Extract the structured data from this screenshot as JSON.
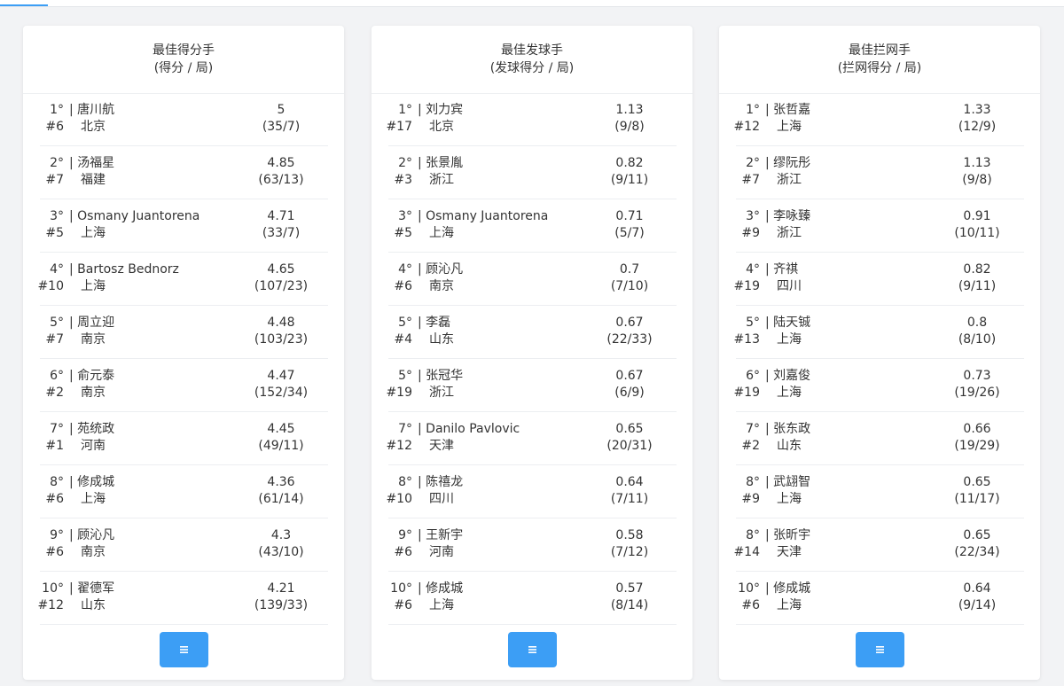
{
  "cards": [
    {
      "title": "最佳得分手",
      "subtitle": "(得分 / 局)",
      "rows": [
        {
          "rank": "1°",
          "number": "#6",
          "name": "| 唐川航",
          "team": "北京",
          "value": "5",
          "ratio": "(35/7)"
        },
        {
          "rank": "2°",
          "number": "#7",
          "name": "| 汤福星",
          "team": "福建",
          "value": "4.85",
          "ratio": "(63/13)"
        },
        {
          "rank": "3°",
          "number": "#5",
          "name": "| Osmany Juantorena",
          "team": "上海",
          "value": "4.71",
          "ratio": "(33/7)"
        },
        {
          "rank": "4°",
          "number": "#10",
          "name": "| Bartosz Bednorz",
          "team": "上海",
          "value": "4.65",
          "ratio": "(107/23)"
        },
        {
          "rank": "5°",
          "number": "#7",
          "name": "| 周立迎",
          "team": "南京",
          "value": "4.48",
          "ratio": "(103/23)"
        },
        {
          "rank": "6°",
          "number": "#2",
          "name": "| 俞元泰",
          "team": "南京",
          "value": "4.47",
          "ratio": "(152/34)"
        },
        {
          "rank": "7°",
          "number": "#1",
          "name": "| 苑统政",
          "team": "河南",
          "value": "4.45",
          "ratio": "(49/11)"
        },
        {
          "rank": "8°",
          "number": "#6",
          "name": "| 修成城",
          "team": "上海",
          "value": "4.36",
          "ratio": "(61/14)"
        },
        {
          "rank": "9°",
          "number": "#6",
          "name": "| 顾沁凡",
          "team": "南京",
          "value": "4.3",
          "ratio": "(43/10)"
        },
        {
          "rank": "10°",
          "number": "#12",
          "name": "| 翟德军",
          "team": "山东",
          "value": "4.21",
          "ratio": "(139/33)"
        }
      ],
      "button_icon": "list-icon"
    },
    {
      "title": "最佳发球手",
      "subtitle": "(发球得分 / 局)",
      "rows": [
        {
          "rank": "1°",
          "number": "#17",
          "name": "| 刘力宾",
          "team": "北京",
          "value": "1.13",
          "ratio": "(9/8)"
        },
        {
          "rank": "2°",
          "number": "#3",
          "name": "| 张景胤",
          "team": "浙江",
          "value": "0.82",
          "ratio": "(9/11)"
        },
        {
          "rank": "3°",
          "number": "#5",
          "name": "| Osmany Juantorena",
          "team": "上海",
          "value": "0.71",
          "ratio": "(5/7)"
        },
        {
          "rank": "4°",
          "number": "#6",
          "name": "| 顾沁凡",
          "team": "南京",
          "value": "0.7",
          "ratio": "(7/10)"
        },
        {
          "rank": "5°",
          "number": "#4",
          "name": "| 李磊",
          "team": "山东",
          "value": "0.67",
          "ratio": "(22/33)"
        },
        {
          "rank": "5°",
          "number": "#19",
          "name": "| 张冠华",
          "team": "浙江",
          "value": "0.67",
          "ratio": "(6/9)"
        },
        {
          "rank": "7°",
          "number": "#12",
          "name": "| Danilo Pavlovic",
          "team": "天津",
          "value": "0.65",
          "ratio": "(20/31)"
        },
        {
          "rank": "8°",
          "number": "#10",
          "name": "| 陈禧龙",
          "team": "四川",
          "value": "0.64",
          "ratio": "(7/11)"
        },
        {
          "rank": "9°",
          "number": "#6",
          "name": "| 王新宇",
          "team": "河南",
          "value": "0.58",
          "ratio": "(7/12)"
        },
        {
          "rank": "10°",
          "number": "#6",
          "name": "| 修成城",
          "team": "上海",
          "value": "0.57",
          "ratio": "(8/14)"
        }
      ],
      "button_icon": "list-icon"
    },
    {
      "title": "最佳拦网手",
      "subtitle": "(拦网得分 / 局)",
      "rows": [
        {
          "rank": "1°",
          "number": "#12",
          "name": "| 张哲嘉",
          "team": "上海",
          "value": "1.33",
          "ratio": "(12/9)"
        },
        {
          "rank": "2°",
          "number": "#7",
          "name": "| 缪阮彤",
          "team": "浙江",
          "value": "1.13",
          "ratio": "(9/8)"
        },
        {
          "rank": "3°",
          "number": "#9",
          "name": "| 李咏臻",
          "team": "浙江",
          "value": "0.91",
          "ratio": "(10/11)"
        },
        {
          "rank": "4°",
          "number": "#19",
          "name": "| 齐祺",
          "team": "四川",
          "value": "0.82",
          "ratio": "(9/11)"
        },
        {
          "rank": "5°",
          "number": "#13",
          "name": "| 陆天铖",
          "team": "上海",
          "value": "0.8",
          "ratio": "(8/10)"
        },
        {
          "rank": "6°",
          "number": "#19",
          "name": "| 刘嘉俊",
          "team": "上海",
          "value": "0.73",
          "ratio": "(19/26)"
        },
        {
          "rank": "7°",
          "number": "#2",
          "name": "| 张东政",
          "team": "山东",
          "value": "0.66",
          "ratio": "(19/29)"
        },
        {
          "rank": "8°",
          "number": "#9",
          "name": "| 武翃智",
          "team": "上海",
          "value": "0.65",
          "ratio": "(11/17)"
        },
        {
          "rank": "8°",
          "number": "#14",
          "name": "| 张昕宇",
          "team": "天津",
          "value": "0.65",
          "ratio": "(22/34)"
        },
        {
          "rank": "10°",
          "number": "#6",
          "name": "| 修成城",
          "team": "上海",
          "value": "0.64",
          "ratio": "(9/14)"
        }
      ],
      "button_icon": "list-icon"
    }
  ],
  "colors": {
    "accent": "#3c9ef5",
    "background": "#f2f3f5",
    "card": "#ffffff",
    "text": "#333333"
  }
}
